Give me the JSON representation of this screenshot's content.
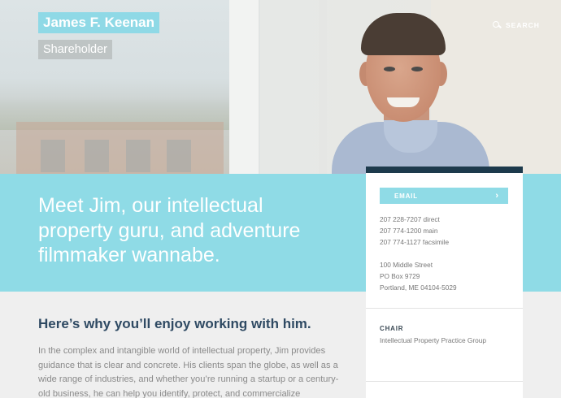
{
  "header": {
    "name": "James F. Keenan",
    "title": "Shareholder",
    "search_label": "SEARCH",
    "search_icon": "search-icon"
  },
  "hero": {
    "tagline": "Meet Jim, our intellectual property guru, and adventure filmmaker wannabe."
  },
  "contact": {
    "email_label": "EMAIL",
    "email_icon": "chevron-right-icon",
    "phones": [
      "207 228-7207 direct",
      "207 774-1200 main",
      "207 774-1127 facsimile"
    ],
    "address": [
      "100 Middle Street",
      "PO Box 9729",
      "Portland, ME 04104-5029"
    ],
    "role_heading": "CHAIR",
    "role_group": "Intellectual Property Practice Group"
  },
  "content": {
    "heading": "Here’s why you’ll enjoy working with him.",
    "paragraph": "In the complex and intangible world of intellectual property, Jim provides guidance that is clear and concrete. His clients span the globe, as well as a wide range of industries, and whether you’re running a startup or a century-old business, he can help you identify, protect, and commercialize"
  },
  "colors": {
    "accent": "#8fdbe6",
    "navy": "#1d3a4c",
    "heading": "#2f4a63"
  }
}
